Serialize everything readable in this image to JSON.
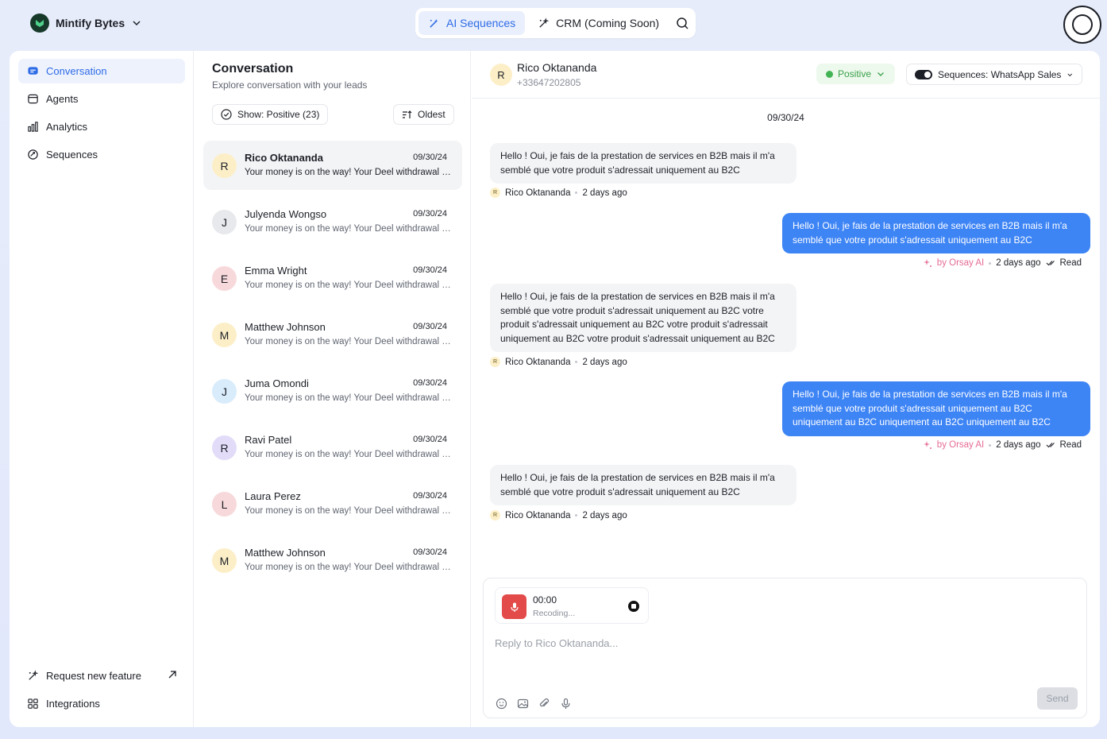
{
  "workspace": {
    "name": "Mintify Bytes"
  },
  "topnav": {
    "tabs": [
      {
        "label": "AI Sequences",
        "active": true
      },
      {
        "label": "CRM (Coming Soon)",
        "active": false
      }
    ]
  },
  "sidebar": {
    "items": [
      {
        "label": "Conversation",
        "icon": "chat-icon",
        "active": true
      },
      {
        "label": "Agents",
        "icon": "agents-icon",
        "active": false
      },
      {
        "label": "Analytics",
        "icon": "bar-chart-icon",
        "active": false
      },
      {
        "label": "Sequences",
        "icon": "sequences-icon",
        "active": false
      }
    ],
    "bottom": [
      {
        "label": "Request new feature",
        "icon": "feature-icon"
      },
      {
        "label": "Integrations",
        "icon": "grid-icon"
      }
    ]
  },
  "list": {
    "title": "Conversation",
    "subtitle": "Explore conversation with your leads",
    "filter_label": "Show: Positive (23)",
    "sort_label": "Oldest",
    "conversations": [
      {
        "initial": "R",
        "name": "Rico Oktananda",
        "date": "09/30/24",
        "preview": "Your money is on the way! Your Deel withdrawal is...",
        "avatar_color": "#fcefc8"
      },
      {
        "initial": "J",
        "name": "Julyenda Wongso",
        "date": "09/30/24",
        "preview": "Your money is on the way! Your Deel withdrawal is...",
        "avatar_color": "#e8e9ec"
      },
      {
        "initial": "E",
        "name": "Emma Wright",
        "date": "09/30/24",
        "preview": "Your money is on the way! Your Deel withdrawal is...",
        "avatar_color": "#f8d9db"
      },
      {
        "initial": "M",
        "name": "Matthew Johnson",
        "date": "09/30/24",
        "preview": "Your money is on the way! Your Deel withdrawal is...",
        "avatar_color": "#fcefc8"
      },
      {
        "initial": "J",
        "name": "Juma Omondi",
        "date": "09/30/24",
        "preview": "Your money is on the way! Your Deel withdrawal is...",
        "avatar_color": "#d9ecfb"
      },
      {
        "initial": "R",
        "name": "Ravi Patel",
        "date": "09/30/24",
        "preview": "Your money is on the way! Your Deel withdrawal is...",
        "avatar_color": "#e2dcf9"
      },
      {
        "initial": "L",
        "name": "Laura Perez",
        "date": "09/30/24",
        "preview": "Your money is on the way! Your Deel withdrawal is...",
        "avatar_color": "#f8d9db"
      },
      {
        "initial": "M",
        "name": "Matthew Johnson",
        "date": "09/30/24",
        "preview": "Your money is on the way! Your Deel withdrawal is...",
        "avatar_color": "#fcefc8"
      }
    ]
  },
  "chat": {
    "contact_initial": "R",
    "contact_name": "Rico Oktananda",
    "contact_phone": "+33647202805",
    "status_label": "Positive",
    "sequence_label": "Sequences: WhatsApp Sales",
    "day": "09/30/24",
    "messages": [
      {
        "dir": "in",
        "text": "Hello ! Oui, je fais de la prestation de services en B2B mais il m'a semblé que votre produit s'adressait uniquement au B2C",
        "sender": "Rico Oktananda",
        "time": "2 days ago"
      },
      {
        "dir": "out",
        "text": "Hello ! Oui, je fais de la prestation de services en B2B mais il m'a semblé que votre produit s'adressait uniquement au B2C",
        "sender": "by Orsay AI",
        "time": "2 days ago",
        "status": "Read"
      },
      {
        "dir": "in",
        "text": "Hello ! Oui, je fais de la prestation de services en B2B mais il m'a semblé que votre produit s'adressait uniquement au B2C votre produit s'adressait uniquement au B2C votre produit s'adressait uniquement au B2C votre produit s'adressait uniquement au B2C",
        "sender": "Rico Oktananda",
        "time": "2 days ago"
      },
      {
        "dir": "out",
        "text": "Hello ! Oui, je fais de la prestation de services en B2B mais il m'a semblé que votre produit s'adressait uniquement au B2C uniquement au B2C uniquement au B2C uniquement au B2C",
        "sender": "by Orsay AI",
        "time": "2 days ago",
        "status": "Read"
      },
      {
        "dir": "in",
        "text": "Hello ! Oui, je fais de la prestation de services en B2B mais il m'a semblé que votre produit s'adressait uniquement au B2C",
        "sender": "Rico Oktananda",
        "time": "2 days ago"
      }
    ]
  },
  "composer": {
    "rec_time": "00:00",
    "rec_label": "Recoding...",
    "placeholder": "Reply to Rico Oktananda...",
    "send_label": "Send"
  }
}
